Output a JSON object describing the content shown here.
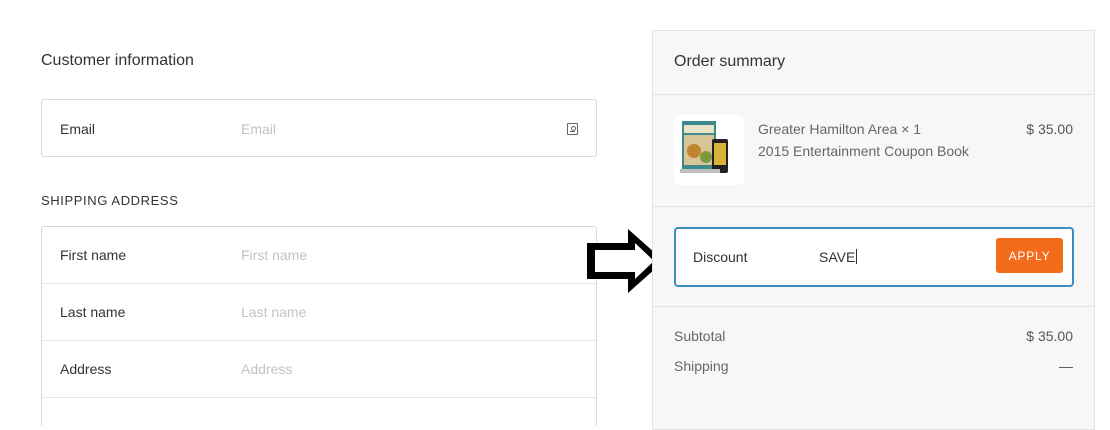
{
  "customer": {
    "title": "Customer information",
    "email_label": "Email",
    "email_placeholder": "Email"
  },
  "shipping": {
    "title": "SHIPPING ADDRESS",
    "fields": [
      {
        "label": "First name",
        "placeholder": "First name"
      },
      {
        "label": "Last name",
        "placeholder": "Last name"
      },
      {
        "label": "Address",
        "placeholder": "Address"
      }
    ]
  },
  "summary": {
    "title": "Order summary",
    "item": {
      "name": "Greater Hamilton Area × 1",
      "subtitle": "2015 Entertainment Coupon Book",
      "price": "$ 35.00"
    },
    "discount": {
      "label": "Discount",
      "value": "SAVE",
      "button": "APPLY"
    },
    "subtotal_label": "Subtotal",
    "subtotal_value": "$ 35.00",
    "shipping_label": "Shipping",
    "shipping_value": "—"
  },
  "colors": {
    "accent": "#f36c19",
    "focus_border": "#3a8fc0"
  },
  "icons": {
    "email_field": "contact-card-icon",
    "annotation": "right-arrow-icon"
  }
}
